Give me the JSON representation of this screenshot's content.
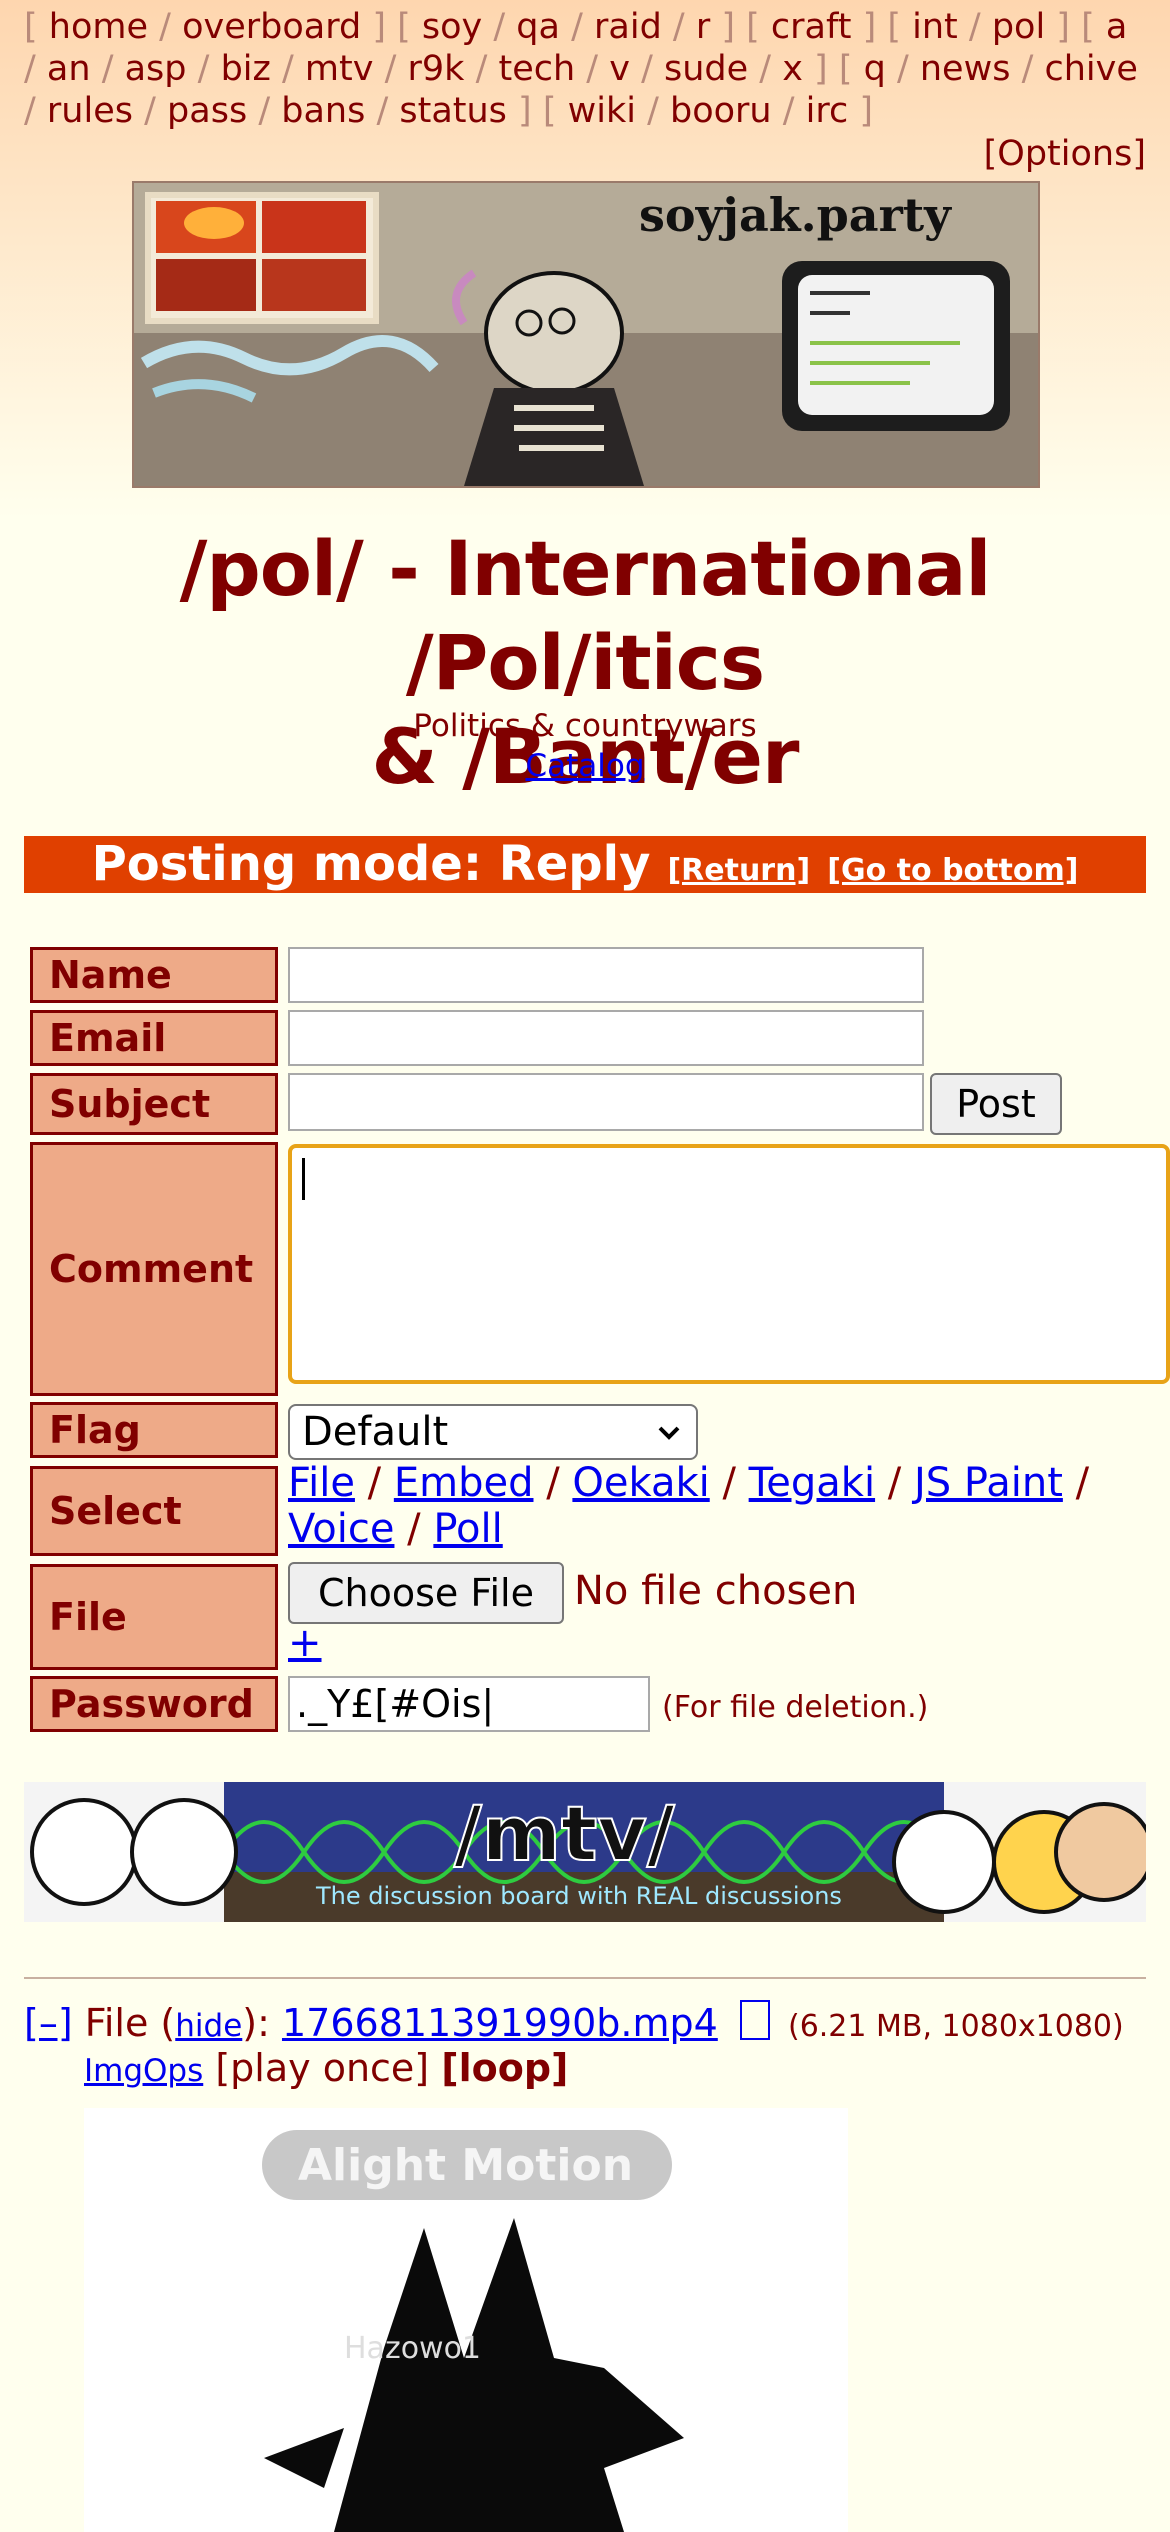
{
  "nav": {
    "row1": [
      {
        "group": [
          "home",
          "overboard"
        ]
      },
      {
        "group": [
          "soy",
          "qa",
          "raid",
          "r"
        ]
      },
      {
        "group": [
          "craft"
        ]
      },
      {
        "group": [
          "int",
          "pol"
        ]
      },
      {
        "group": [
          "a",
          "an",
          "asp",
          "biz",
          "mtv",
          "r9k",
          "tech",
          "v",
          "sude",
          "x"
        ]
      },
      {
        "group": [
          "q",
          "news",
          "chive",
          "rules",
          "pass",
          "bans",
          "status"
        ]
      },
      {
        "group": [
          "wiki",
          "booru",
          "irc"
        ]
      }
    ],
    "options": "[Options]"
  },
  "banner": {
    "site_text": "soyjak.party"
  },
  "board": {
    "title_line1": "/pol/ - International /Pol/itics",
    "title_line2": "& /Bant/er",
    "subtitle": "Politics & countrywars",
    "catalog": "Catalog"
  },
  "posting": {
    "mode": "Posting mode: Reply",
    "return": "[Return]",
    "bottom": "[Go to bottom]"
  },
  "form": {
    "name_label": "Name",
    "email_label": "Email",
    "subject_label": "Subject",
    "post_button": "Post",
    "comment_label": "Comment",
    "flag_label": "Flag",
    "flag_value": "Default",
    "select_label": "Select",
    "select_options": [
      "File",
      "Embed",
      "Oekaki",
      "Tegaki",
      "JS Paint",
      "Voice",
      "Poll"
    ],
    "file_label": "File",
    "choose_file": "Choose File",
    "no_file": "No file chosen",
    "add_more": "+",
    "password_label": "Password",
    "password_value": "._Y£[#Ois|",
    "password_note": "(For file deletion.)"
  },
  "mtv_banner": {
    "title": "/mtv/",
    "tagline": "The discussion board with REAL discussions"
  },
  "post": {
    "collapse": "[–]",
    "file_prefix": "File (",
    "hide": "hide",
    "file_mid": "): ",
    "filename": "1766811391990b.mp4",
    "meta": "(6.21 MB, 1080x1080)",
    "imgops": "ImgOps",
    "play_once": "[play once]",
    "loop": "[loop]",
    "thumb_watermark": "Alight Motion",
    "thumb_credit": "Hazowo1"
  }
}
